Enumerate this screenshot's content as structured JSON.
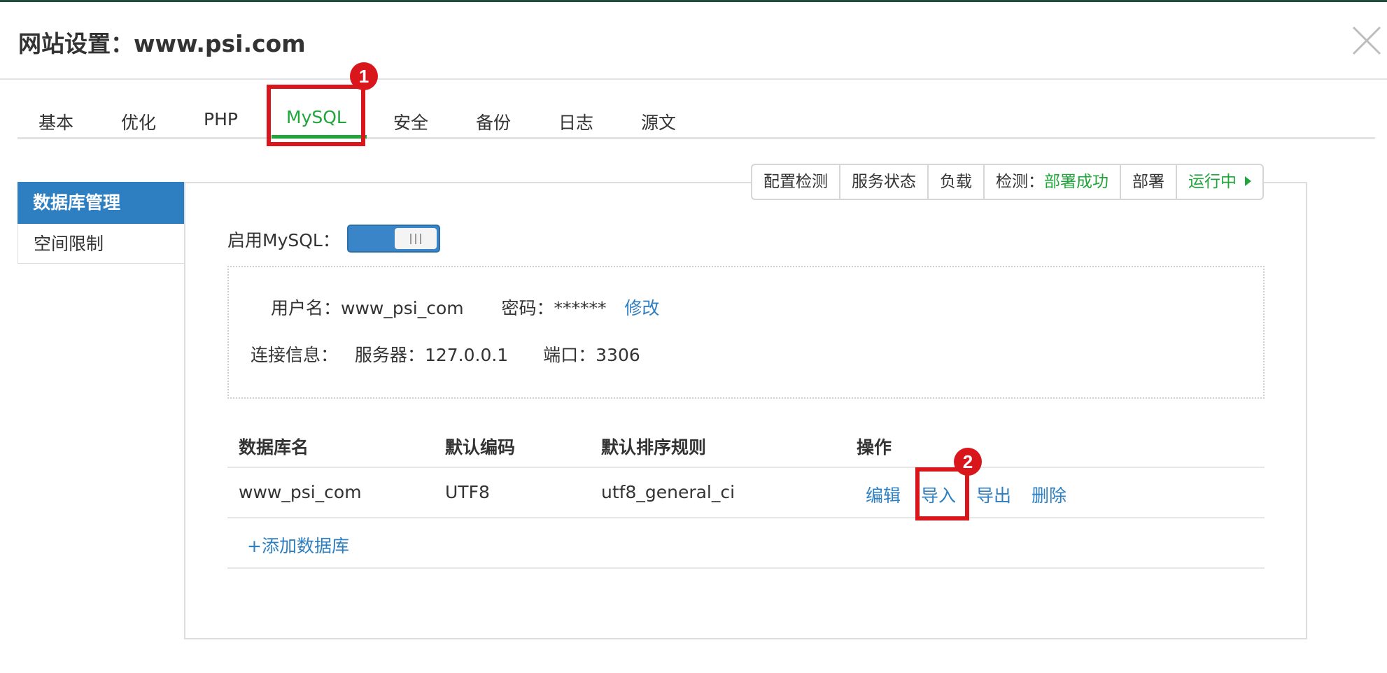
{
  "dialog": {
    "title": "网站设置：www.psi.com",
    "close_label": "×"
  },
  "tabs": [
    {
      "label": "基本"
    },
    {
      "label": "优化"
    },
    {
      "label": "PHP"
    },
    {
      "label": "MySQL",
      "active": true
    },
    {
      "label": "安全"
    },
    {
      "label": "备份"
    },
    {
      "label": "日志"
    },
    {
      "label": "源文"
    }
  ],
  "left_nav": [
    {
      "label": "数据库管理",
      "active": true
    },
    {
      "label": "空间限制"
    }
  ],
  "status_bar": {
    "config_check": "配置检测",
    "service_status": "服务状态",
    "load": "负载",
    "check_label": "检测：",
    "check_value": "部署成功",
    "deploy": "部署",
    "running": "运行中"
  },
  "mysql": {
    "enable_label": "启用MySQL：",
    "enabled": true
  },
  "account": {
    "username_label": "用户名：",
    "username": "www_psi_com",
    "password_label": "密码：",
    "password": "******",
    "modify_link": "修改",
    "connection_label": "连接信息：",
    "server_label": "服务器：",
    "server": "127.0.0.1",
    "port_label": "端口：",
    "port": "3306"
  },
  "db_table": {
    "headers": [
      "数据库名",
      "默认编码",
      "默认排序规则",
      "操作"
    ],
    "rows": [
      {
        "name": "www_psi_com",
        "encoding": "UTF8",
        "collation": "utf8_general_ci",
        "actions": [
          "编辑",
          "导入",
          "导出",
          "删除"
        ]
      }
    ],
    "add_link": "+添加数据库"
  },
  "annotations": [
    {
      "number": "1"
    },
    {
      "number": "2"
    }
  ],
  "colors": {
    "accent_green": "#20a53a",
    "link_blue": "#2d7fc2",
    "annotation_red": "#d9161b"
  }
}
